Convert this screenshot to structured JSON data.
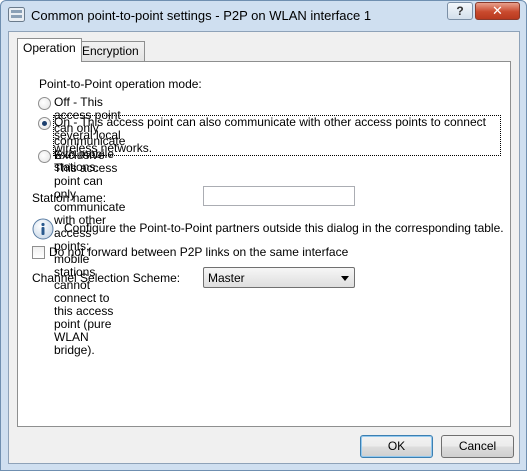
{
  "window": {
    "title": "Common point-to-point settings - P2P on WLAN interface 1",
    "help_label": "?",
    "close_label": "✕"
  },
  "tabs": [
    {
      "label": "Operation",
      "active": true
    },
    {
      "label": "Encryption",
      "active": false
    }
  ],
  "operation": {
    "mode_heading": "Point-to-Point operation mode:",
    "modes": [
      {
        "label": "Off - This access point can only communicate with mobile stations.",
        "checked": false
      },
      {
        "label": "On - This access point can also communicate with other access points to connect several local",
        "label_line2": "wireless networks.",
        "checked": true
      },
      {
        "label": "Exclusive - This access point can only communicate with other access points; mobile stations",
        "label_line2": "cannot connect to this access point (pure WLAN bridge).",
        "checked": false
      }
    ],
    "station_name_label": "Station name:",
    "station_name_value": "",
    "info_text": "Configure the Point-to-Point partners outside this dialog in the corresponding table.",
    "no_forward_label": "Do not forward between P2P links on the same interface",
    "no_forward_checked": false,
    "channel_scheme_label": "Channel Selection Scheme:",
    "channel_scheme_value": "Master"
  },
  "buttons": {
    "ok_label": "OK",
    "cancel_label": "Cancel"
  },
  "colors": {
    "titlebar": "#cfdff0",
    "close_button": "#c94a2e",
    "default_button_border": "#3c7fb1"
  }
}
